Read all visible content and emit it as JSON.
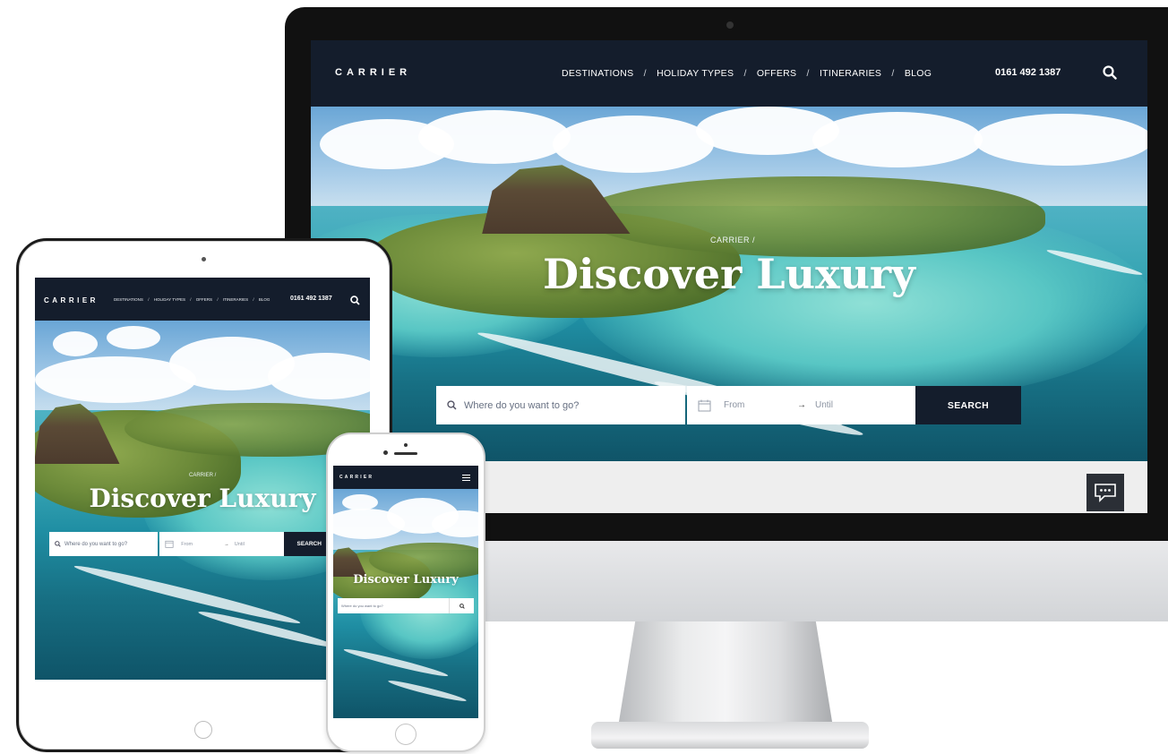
{
  "desktop": {
    "logo": "CARRIER",
    "nav": [
      {
        "label": "DESTINATIONS"
      },
      {
        "label": "HOLIDAY TYPES"
      },
      {
        "label": "OFFERS"
      },
      {
        "label": "ITINERARIES"
      },
      {
        "label": "BLOG"
      }
    ],
    "separator": "/",
    "phone": "0161 492 1387",
    "breadcrumb": "CARRIER /",
    "hero_title": "Discover Luxury",
    "search": {
      "where_placeholder": "Where do you want to go?",
      "from_label": "From",
      "arrow": "→",
      "until_label": "Until",
      "button_label": "SEARCH"
    },
    "icons": {
      "search": "search-icon",
      "calendar": "calendar-icon",
      "chat": "chat-icon"
    }
  },
  "tablet": {
    "logo": "CARRIER",
    "nav": [
      {
        "label": "DESTINATIONS"
      },
      {
        "label": "HOLIDAY TYPES"
      },
      {
        "label": "OFFERS"
      },
      {
        "label": "ITINERARIES"
      },
      {
        "label": "BLOG"
      }
    ],
    "separator": "/",
    "phone": "0161 492 1387",
    "breadcrumb": "CARRIER /",
    "hero_title": "Discover Luxury",
    "search": {
      "where_placeholder": "Where do you want to go?",
      "from_label": "From",
      "arrow": "→",
      "until_label": "Until",
      "button_label": "SEARCH"
    }
  },
  "mobile": {
    "logo": "CARRIER",
    "hero_title": "Discover Luxury",
    "search": {
      "where_placeholder": "Where do you want to go?"
    },
    "icons": {
      "menu": "hamburger-menu-icon",
      "search": "search-icon",
      "chat": "chat-icon"
    }
  },
  "colors": {
    "nav_bg": "#141d2c",
    "button_bg": "#141d2c",
    "chat_bg": "#2b2f36",
    "text_light": "#ffffff"
  }
}
